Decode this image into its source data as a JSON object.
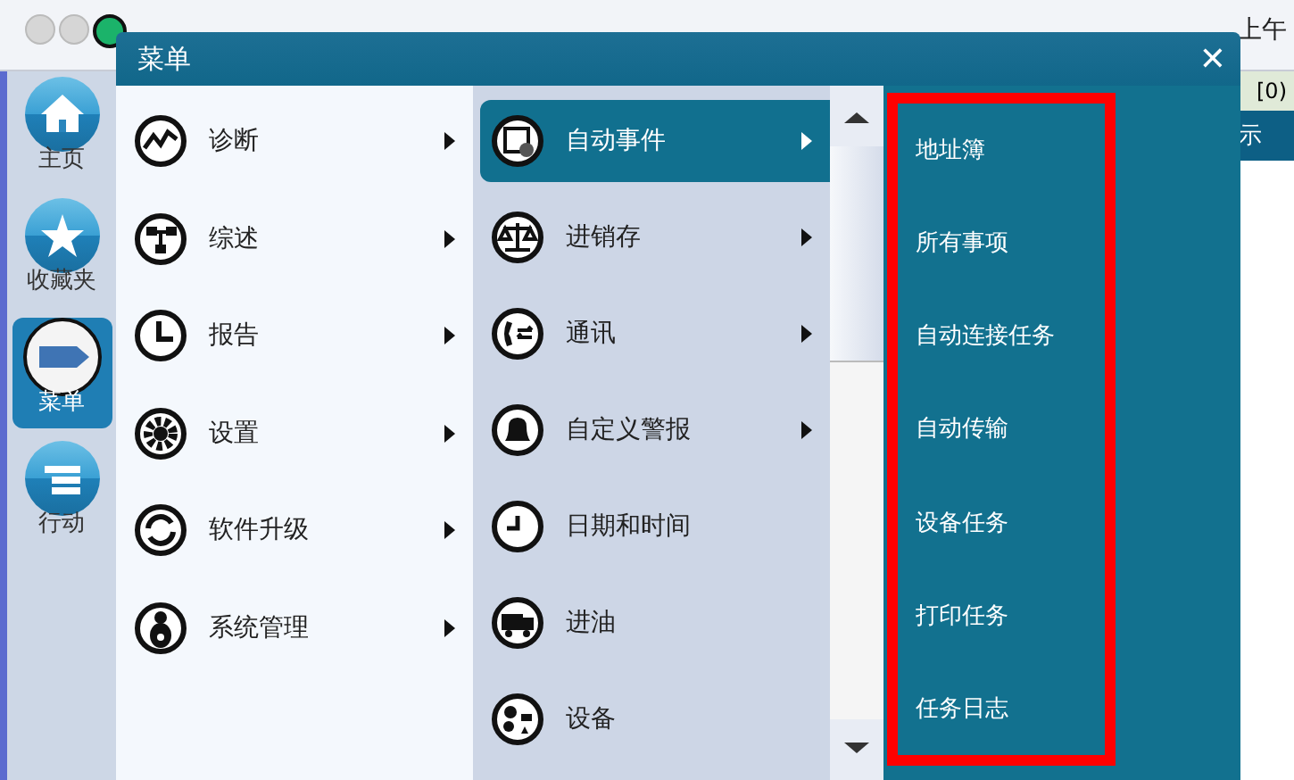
{
  "background": {
    "clock_text": "上午",
    "counter_text": "[0)",
    "column_text": "示"
  },
  "sidebar": {
    "items": [
      {
        "label": "主页",
        "selected": false
      },
      {
        "label": "收藏夹",
        "selected": false
      },
      {
        "label": "菜单",
        "selected": true
      },
      {
        "label": "行动",
        "selected": false
      }
    ]
  },
  "menu_window": {
    "title": "菜单",
    "close": "✕",
    "column_1": [
      {
        "label": "诊断",
        "submenu": true
      },
      {
        "label": "综述",
        "submenu": true
      },
      {
        "label": "报告",
        "submenu": true
      },
      {
        "label": "设置",
        "submenu": true
      },
      {
        "label": "软件升级",
        "submenu": true
      },
      {
        "label": "系统管理",
        "submenu": true
      }
    ],
    "column_2": [
      {
        "label": "自动事件",
        "submenu": true,
        "selected": true
      },
      {
        "label": "进销存",
        "submenu": true,
        "selected": false
      },
      {
        "label": "通讯",
        "submenu": true,
        "selected": false
      },
      {
        "label": "自定义警报",
        "submenu": true,
        "selected": false
      },
      {
        "label": "日期和时间",
        "submenu": false,
        "selected": false
      },
      {
        "label": "进油",
        "submenu": false,
        "selected": false
      },
      {
        "label": "设备",
        "submenu": false,
        "selected": false
      }
    ],
    "column_3": [
      {
        "label": "地址簿"
      },
      {
        "label": "所有事项"
      },
      {
        "label": "自动连接任务"
      },
      {
        "label": "自动传输"
      },
      {
        "label": "设备任务"
      },
      {
        "label": "打印任务"
      },
      {
        "label": "任务日志"
      }
    ]
  }
}
